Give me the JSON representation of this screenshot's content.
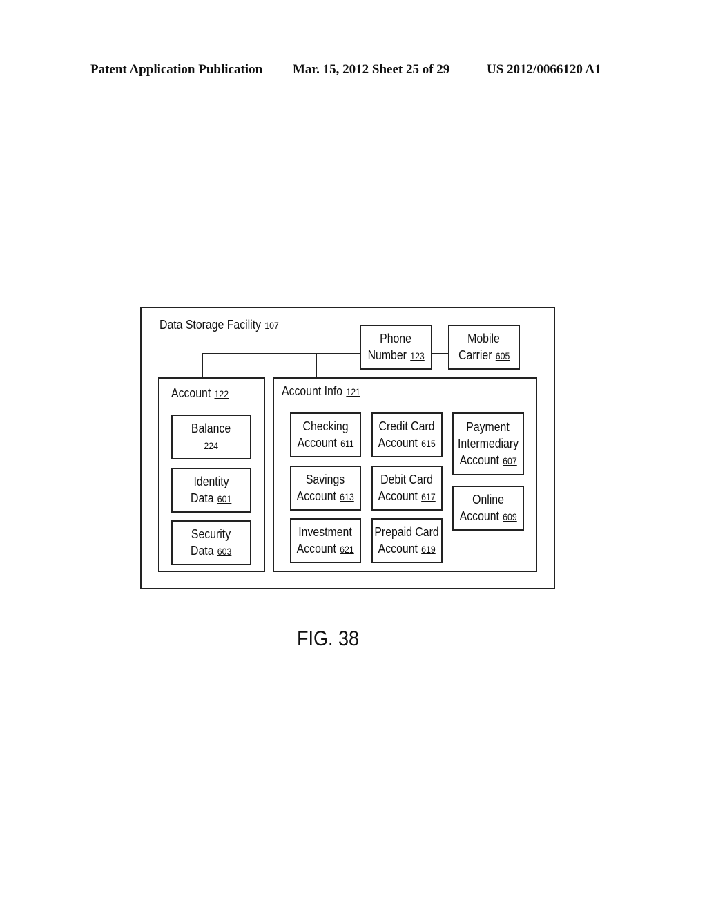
{
  "header": {
    "left": "Patent Application Publication",
    "center": "Mar. 15, 2012  Sheet 25 of 29",
    "right": "US 2012/0066120 A1"
  },
  "diagram": {
    "outer": {
      "label": "Data Storage Facility",
      "ref": "107"
    },
    "phone": {
      "line1": "Phone",
      "line2": "Number",
      "ref": "123"
    },
    "carrier": {
      "line1": "Mobile",
      "line2": "Carrier",
      "ref": "605"
    },
    "account": {
      "label": "Account",
      "ref": "122",
      "items": [
        {
          "line1": "Balance",
          "line2": "",
          "ref": "224"
        },
        {
          "line1": "Identity",
          "line2": "Data",
          "ref": "601"
        },
        {
          "line1": "Security",
          "line2": "Data",
          "ref": "603"
        }
      ]
    },
    "account_info": {
      "label": "Account Info",
      "ref": "121",
      "items": [
        {
          "line1": "Checking",
          "line2": "Account",
          "ref": "611"
        },
        {
          "line1": "Savings",
          "line2": "Account",
          "ref": "613"
        },
        {
          "line1": "Investment",
          "line2": "Account",
          "ref": "621"
        },
        {
          "line1": "Credit Card",
          "line2": "Account",
          "ref": "615"
        },
        {
          "line1": "Debit Card",
          "line2": "Account",
          "ref": "617"
        },
        {
          "line1": "Prepaid Card",
          "line2": "Account",
          "ref": "619"
        },
        {
          "line1": "Payment",
          "line1b": "Intermediary",
          "line2": "Account",
          "ref": "607"
        },
        {
          "line1": "Online",
          "line2": "Account",
          "ref": "609"
        }
      ]
    }
  },
  "figure_label": "FIG. 38"
}
